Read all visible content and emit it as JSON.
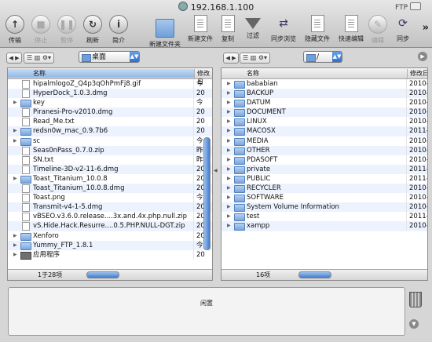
{
  "title": "192.168.1.100",
  "protocol_badge": "FTP",
  "toolbar": {
    "transfer": "传输",
    "stop": "停止",
    "pause": "暂停",
    "refresh": "刷新",
    "info": "简介",
    "new_folder": "新建文件夹",
    "new_file": "新建文件",
    "copy": "复制",
    "filter": "过滤",
    "sync_browse": "同步浏览",
    "hidden_files": "隐藏文件",
    "quick_edit": "快速编辑",
    "edit": "编辑",
    "sync": "同步"
  },
  "left": {
    "path": "桌面",
    "col_name": "名称",
    "col_date": "修改日",
    "status": "1于28项",
    "items": [
      {
        "name": "hipalmlogoZ_Q4p3qOhPmFj8.gif",
        "date": "今",
        "type": "file",
        "expandable": false
      },
      {
        "name": "HyperDock_1.0.3.dmg",
        "date": "20",
        "type": "file",
        "expandable": false
      },
      {
        "name": "key",
        "date": "今",
        "type": "folder",
        "expandable": true
      },
      {
        "name": "Piranesi-Pro-v2010.dmg",
        "date": "20",
        "type": "file",
        "expandable": false
      },
      {
        "name": "Read_Me.txt",
        "date": "20",
        "type": "file",
        "expandable": false
      },
      {
        "name": "redsn0w_mac_0.9.7b6",
        "date": "20",
        "type": "folder",
        "expandable": true
      },
      {
        "name": "sc",
        "date": "今",
        "type": "folder",
        "expandable": true
      },
      {
        "name": "Seas0nPass_0.7.0.zip",
        "date": "昨",
        "type": "file",
        "expandable": false
      },
      {
        "name": "SN.txt",
        "date": "昨",
        "type": "file",
        "expandable": false
      },
      {
        "name": "Timeline-3D-v2-11-6.dmg",
        "date": "20",
        "type": "file",
        "expandable": false
      },
      {
        "name": "Toast_Titanium_10.0.8",
        "date": "20",
        "type": "folder",
        "expandable": true
      },
      {
        "name": "Toast_Titanium_10.0.8.dmg",
        "date": "20",
        "type": "file",
        "expandable": false
      },
      {
        "name": "Toast.png",
        "date": "今",
        "type": "file",
        "expandable": false
      },
      {
        "name": "Transmit-v4-1-5.dmg",
        "date": "20",
        "type": "file",
        "expandable": false
      },
      {
        "name": "vBSEO.v3.6.0.release....3x.and.4x.php.null.zip",
        "date": "20",
        "type": "file",
        "expandable": false
      },
      {
        "name": "vS.Hide.Hack.Resurre....0.5.PHP.NULL-DGT.zip",
        "date": "20",
        "type": "file",
        "expandable": false
      },
      {
        "name": "Xenforo",
        "date": "20",
        "type": "folder",
        "expandable": true
      },
      {
        "name": "Yummy_FTP_1.8.1",
        "date": "今",
        "type": "folder",
        "expandable": true
      },
      {
        "name": "应用程序",
        "date": "20",
        "type": "app",
        "expandable": true
      }
    ]
  },
  "right": {
    "path": "/",
    "col_name": "名称",
    "col_date": "修改日",
    "status": "16项",
    "items": [
      {
        "name": "bababian",
        "date": "2010-"
      },
      {
        "name": "BACKUP",
        "date": "2010-"
      },
      {
        "name": "DATUM",
        "date": "2010-"
      },
      {
        "name": "DOCUMENT",
        "date": "2010-"
      },
      {
        "name": "LINUX",
        "date": "2010-"
      },
      {
        "name": "MACOSX",
        "date": "2011-"
      },
      {
        "name": "MEDIA",
        "date": "2010-"
      },
      {
        "name": "OTHER",
        "date": "2010-"
      },
      {
        "name": "PDASOFT",
        "date": "2010-"
      },
      {
        "name": "private",
        "date": "2011-"
      },
      {
        "name": "PUBLIC",
        "date": "2011-"
      },
      {
        "name": "RECYCLER",
        "date": "2010-"
      },
      {
        "name": "SOFTWARE",
        "date": "2010-"
      },
      {
        "name": "System Volume Information",
        "date": "2010-"
      },
      {
        "name": "test",
        "date": "2011-"
      },
      {
        "name": "xampp",
        "date": "2010-"
      }
    ]
  },
  "log": {
    "status": "闲置"
  }
}
